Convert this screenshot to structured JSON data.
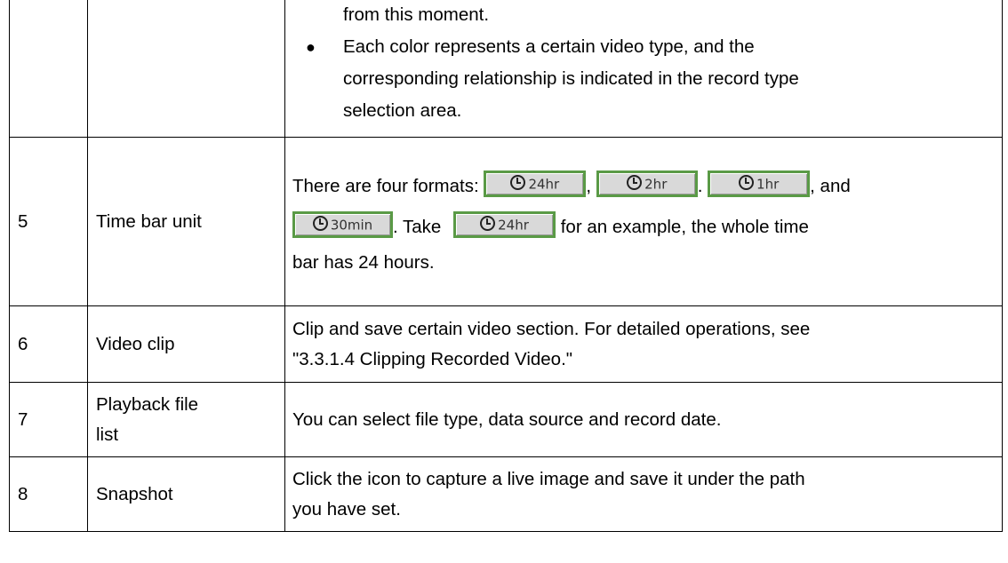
{
  "table": {
    "row_continued": {
      "text_continued": "from this moment.",
      "bullet": "●",
      "bullet_text_line1": "Each color represents a certain video type, and the",
      "bullet_text_line2": "corresponding relationship is indicated in the record type",
      "bullet_text_line3": "selection area."
    },
    "row5": {
      "number": "5",
      "name": "Time bar unit",
      "text_intro": "There are four formats: ",
      "sep1": ",",
      "sep2": ".",
      "sep3": ", and",
      "text_take": ". Take",
      "text_example": " for an example, the whole time",
      "text_end": "bar has 24 hours.",
      "buttons": {
        "btn_24hr": "24hr",
        "btn_2hr": "2hr",
        "btn_1hr": "1hr",
        "btn_30min": "30min"
      }
    },
    "row6": {
      "number": "6",
      "name": "Video clip",
      "desc_line1": "Clip and save certain video section. For detailed operations, see",
      "desc_line2": "\"3.3.1.4 Clipping Recorded Video.\""
    },
    "row7": {
      "number": "7",
      "name_line1": "Playback file",
      "name_line2": "list",
      "desc": "You can select file type, data source and record date."
    },
    "row8": {
      "number": "8",
      "name": "Snapshot",
      "desc_line1": "Click the icon to capture a live image and save it under the path",
      "desc_line2": "you have set."
    }
  },
  "icons": {
    "clock": "clock-icon"
  },
  "colors": {
    "button_border": "#5a9a46",
    "button_bg": "#d9d9d9"
  }
}
